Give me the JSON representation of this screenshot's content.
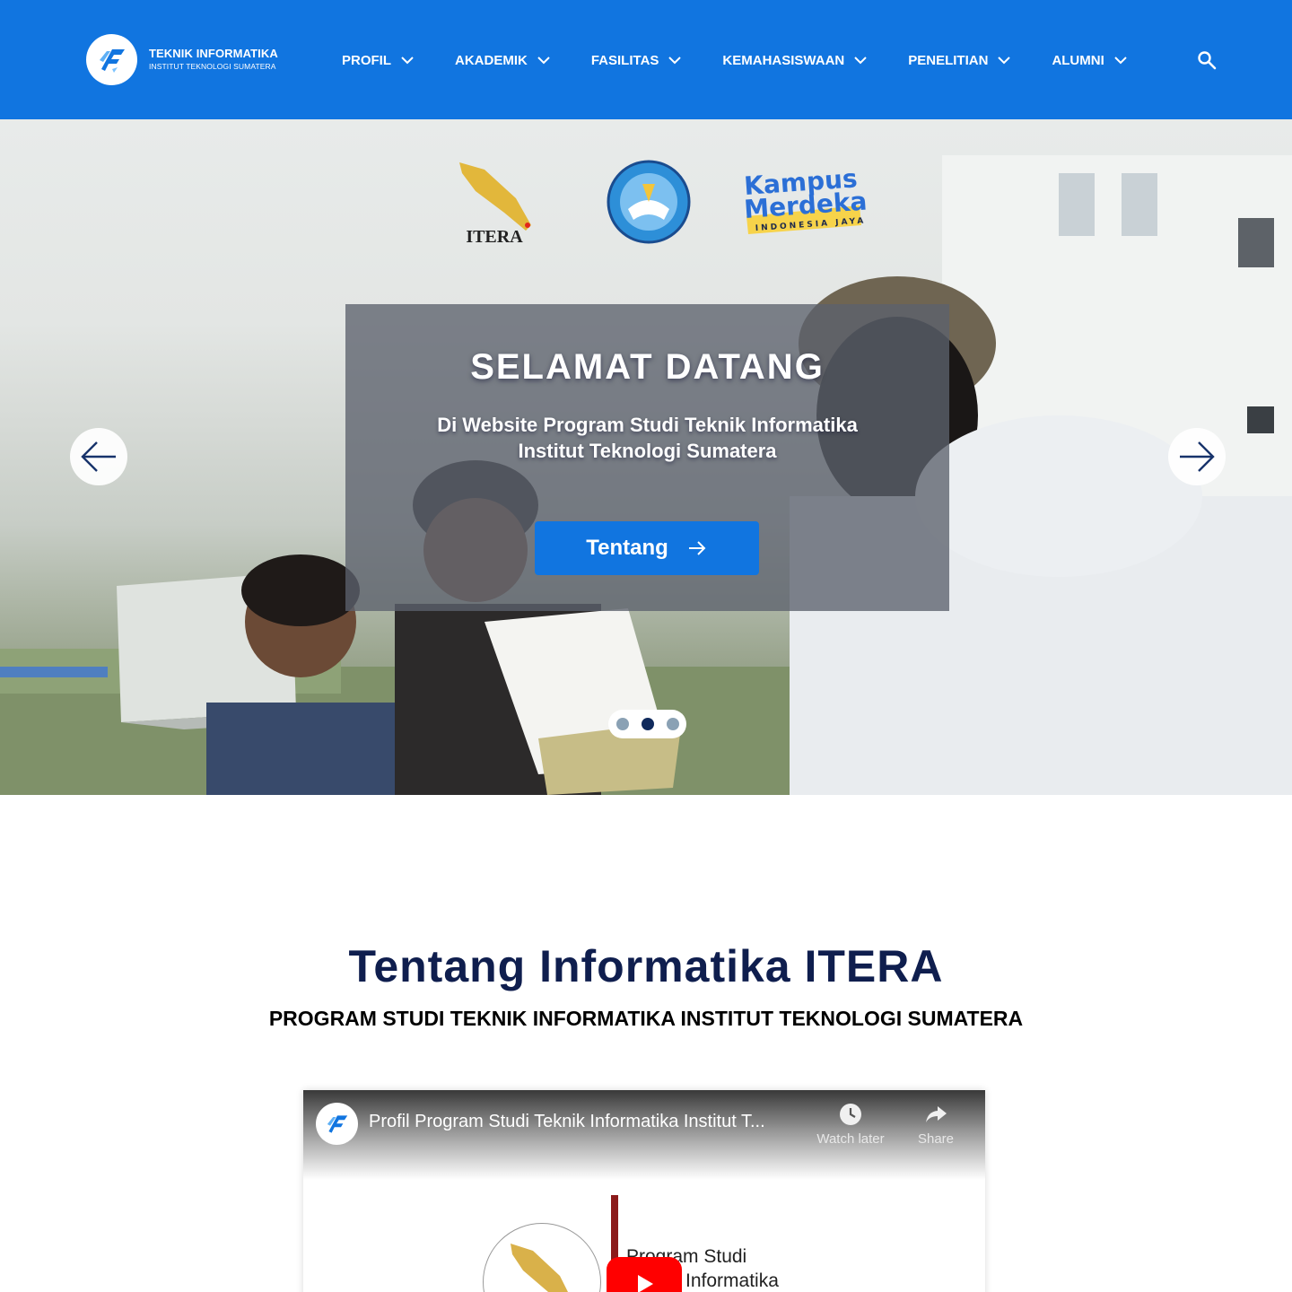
{
  "header": {
    "brand_title": "TEKNIK INFORMATIKA",
    "brand_subtitle": "INSTITUT TEKNOLOGI SUMATERA",
    "nav": [
      {
        "label": "PROFIL"
      },
      {
        "label": "AKADEMIK"
      },
      {
        "label": "FASILITAS"
      },
      {
        "label": "KEMAHASISWAAN"
      },
      {
        "label": "PENELITIAN"
      },
      {
        "label": "ALUMNI"
      }
    ],
    "search_icon": "search-icon"
  },
  "hero": {
    "logos": {
      "itera_text": "ITERA",
      "tutwuri_text": "TUT WURI HANDAYANI",
      "kampus_line1": "Kampus",
      "kampus_line2": "Merdeka",
      "kampus_line3": "INDONESIA JAYA"
    },
    "title": "SELAMAT DATANG",
    "subtitle_line1": "Di Website Program Studi Teknik Informatika",
    "subtitle_line2": "Institut Teknologi Sumatera",
    "cta_label": "Tentang",
    "slide_count": 3,
    "active_slide": 2
  },
  "about": {
    "title": "Tentang Informatika ITERA",
    "subtitle": "PROGRAM STUDI TEKNIK INFORMATIKA INSTITUT TEKNOLOGI SUMATERA"
  },
  "video": {
    "title": "Profil Program Studi Teknik Informatika Institut T...",
    "watch_later": "Watch later",
    "share": "Share",
    "caption_line1": "Program Studi",
    "caption_line2": "Informatika"
  },
  "colors": {
    "primary": "#1175e0",
    "heading": "#0f1e4e",
    "overlay": "#5c626d",
    "dot_active": "#102a5c",
    "dot_inactive": "#8aa1b4"
  }
}
